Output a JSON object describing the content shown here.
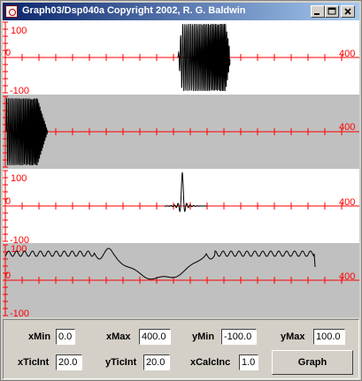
{
  "window": {
    "title": "Graph03/Dsp040a Copyright 2002, R. G. Baldwin"
  },
  "axes": {
    "y_top_label": "100",
    "y_zero_label": "0",
    "y_bottom_label": "-100",
    "x_end_label": "400"
  },
  "colors": {
    "axis": "#ff0000",
    "curve": "#000000",
    "band_light": "#ffffff",
    "band_dark": "#c0c0c0",
    "title_start": "#0a246a",
    "title_end": "#a6caf0"
  },
  "controls": {
    "xMin": {
      "label": "xMin",
      "value": "0.0"
    },
    "xMax": {
      "label": "xMax",
      "value": "400.0"
    },
    "yMin": {
      "label": "yMin",
      "value": "-100.0"
    },
    "yMax": {
      "label": "yMax",
      "value": "100.0"
    },
    "xTicInt": {
      "label": "xTicInt",
      "value": "20.0"
    },
    "yTicInt": {
      "label": "yTicInt",
      "value": "20.0"
    },
    "xCalcInc": {
      "label": "xCalcInc",
      "value": "1.0"
    },
    "graph_button": "Graph"
  }
}
